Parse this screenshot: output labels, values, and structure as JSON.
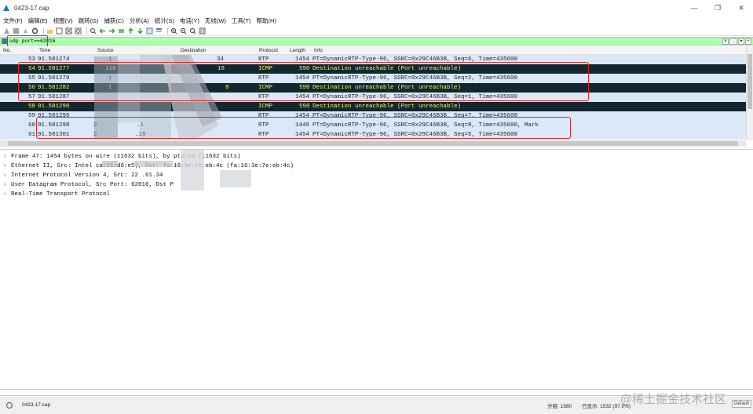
{
  "window": {
    "title": "0423-17.cap",
    "minimize": "—",
    "restore": "❐",
    "close": "✕"
  },
  "menu": [
    "文件(F)",
    "编辑(E)",
    "视图(V)",
    "跳转(G)",
    "捕获(C)",
    "分析(A)",
    "统计(S)",
    "电话(Y)",
    "无线(W)",
    "工具(T)",
    "帮助(H)"
  ],
  "toolbar_icons": [
    "start-capture-icon",
    "stop-capture-icon",
    "restart-capture-icon",
    "capture-options-icon",
    "open-file-icon",
    "save-file-icon",
    "close-file-icon",
    "reload-icon",
    "find-packet-icon",
    "go-back-icon",
    "go-forward-icon",
    "go-to-packet-icon",
    "go-first-icon",
    "go-last-icon",
    "autoscroll-icon",
    "colorize-icon",
    "zoom-in-icon",
    "zoom-out-icon",
    "zoom-reset-icon",
    "resize-columns-icon"
  ],
  "filter": {
    "value": "udp port==62016",
    "clear": "✕",
    "apply": "→",
    "dropdown": "▾",
    "add": "+"
  },
  "columns": {
    "no": "No.",
    "time": "Time",
    "source": "Source",
    "destination": "Destination",
    "protocol": "Protocol",
    "length": "Length",
    "info": "Info"
  },
  "packets": [
    {
      "no": "53",
      "time": "91.581274",
      "src": "1",
      "dst": "34",
      "protocol": "RTP",
      "length": "1454",
      "info": "PT=DynamicRTP-Type-96, SSRC=0x29C46B3B, Seq=6, Time=435600",
      "kind": "rtp"
    },
    {
      "no": "54",
      "time": "91.581277",
      "src": "110",
      "dst": "18",
      "protocol": "ICMP",
      "length": "590",
      "info": "Destination unreachable (Port unreachable)",
      "kind": "icmp"
    },
    {
      "no": "55",
      "time": "91.581279",
      "src": "1",
      "dst": "",
      "protocol": "RTP",
      "length": "1454",
      "info": "PT=DynamicRTP-Type-96, SSRC=0x29C46B3B, Seq=2, Time=435600",
      "kind": "rtp"
    },
    {
      "no": "56",
      "time": "91.581282",
      "src": "1",
      "dst": "8",
      "protocol": "ICMP",
      "length": "590",
      "info": "Destination unreachable (Port unreachable)",
      "kind": "icmp"
    },
    {
      "no": "57",
      "time": "91.581287",
      "src": "",
      "dst": "",
      "protocol": "RTP",
      "length": "1454",
      "info": "PT=DynamicRTP-Type-96, SSRC=0x29C46B3B, Seq=1, Time=435600",
      "kind": "rtp"
    },
    {
      "no": "58",
      "time": "91.581290",
      "src": "",
      "dst": "",
      "protocol": "ICMP",
      "length": "590",
      "info": "Destination unreachable (Port unreachable)",
      "kind": "icmp"
    },
    {
      "no": "59",
      "time": "91.581295",
      "src": "",
      "dst": "",
      "protocol": "RTP",
      "length": "1454",
      "info": "PT=DynamicRTP-Type-96, SSRC=0x29C46B3B, Seq=7, Time=435600",
      "kind": "rtp"
    },
    {
      "no": "60",
      "time": "91.581298",
      "src": "2",
      "dst": ".1",
      "protocol": "RTP",
      "length": "1446",
      "info": "PT=DynamicRTP-Type-96, SSRC=0x29C46B3B, Seq=8, Time=435600, Mark",
      "kind": "rtp"
    },
    {
      "no": "61",
      "time": "91.581301",
      "src": "2",
      "dst": ".18",
      "protocol": "RTP",
      "length": "1454",
      "info": "PT=DynamicRTP-Type-96, SSRC=0x29C46B3B, Seq=5, Time=435600",
      "kind": "rtp"
    }
  ],
  "details": [
    "Frame 47: 1454 bytes on wire (11632 bits),      by    ptured (11632 bits)",
    "Ethernet II, Src: Intel         ca:21:d6:e5), Dst: fa:16:3e:7e:eb:4c (fa:16:3e:7e:eb:4c)",
    "Internet Protocol Version 4, Src: 22         .61.34",
    "User Datagram Protocol, Src Port: 62016, Dst P",
    "Real-Time Transport Protocol"
  ],
  "status": {
    "file": "0423-17.cap",
    "packets": "分组: 1580",
    "displayed": "· 已显示: 1532 (97.0%)",
    "profile": "Default"
  },
  "watermark": "@稀土掘金技术社区",
  "colors": {
    "icmp_bg": "#12272e",
    "icmp_fg": "#f7f75a",
    "rtp_bg": "#dae8f7",
    "filter_ok": "#afffaf",
    "highlight": "#e0262a"
  }
}
